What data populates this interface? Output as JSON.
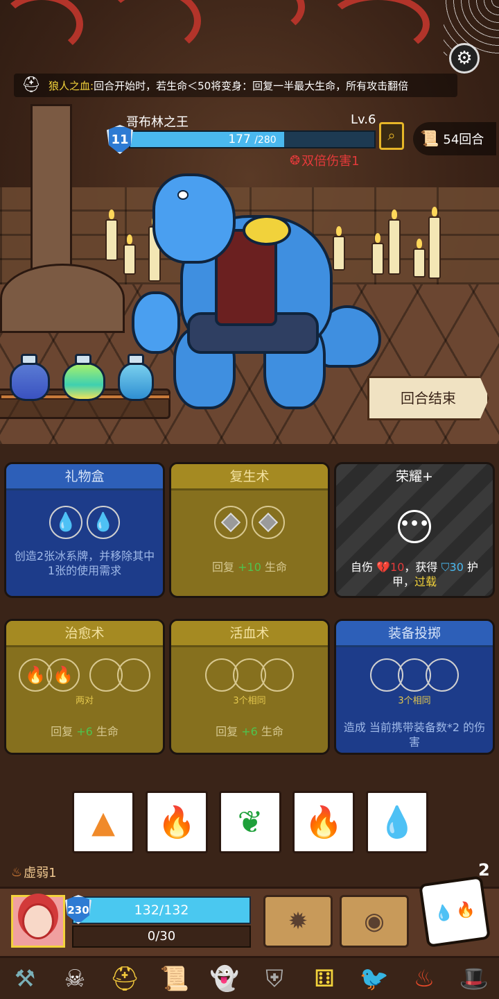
{
  "passive": {
    "icon": "knight-helmet-icon",
    "name": "狼人之血:",
    "text": "回合开始时，若生命＜50将变身：回复一半最大生命，所有攻击翻倍"
  },
  "enemy": {
    "name": "哥布林之王",
    "level": "Lv.6",
    "shield": "11",
    "hp_current": "177",
    "hp_max": "/280",
    "hp_fraction": 0.632,
    "buff": "双倍伤害1"
  },
  "turn_counter": "54回合",
  "end_turn_label": "回合结束",
  "cards": [
    {
      "title": "礼物盒",
      "desc": "创造2张冰系牌，并移除其中1张的使用需求",
      "color": "blue"
    },
    {
      "title": "复生术",
      "desc_prefix": "回复 ",
      "desc_plus": "+10",
      "desc_suffix": " 生命",
      "color": "olive"
    },
    {
      "title": "荣耀+",
      "desc_a": "自伤 ",
      "desc_a_num": "10",
      "desc_b": "，获得 ",
      "desc_b_num": "30",
      "desc_c": " 护甲，",
      "desc_d": "过载",
      "color": "grey"
    },
    {
      "title": "治愈术",
      "req": "两对",
      "desc_prefix": "回复 ",
      "desc_plus": "+6",
      "desc_suffix": " 生命",
      "color": "olive"
    },
    {
      "title": "活血术",
      "req": "3个相同",
      "desc_prefix": "回复 ",
      "desc_plus": "+6",
      "desc_suffix": " 生命",
      "color": "olive"
    },
    {
      "title": "装备投掷",
      "req": "3个相同",
      "desc": "造成 当前携带装备数*2 的伤害",
      "color": "blue"
    }
  ],
  "dice": [
    {
      "face": "earth",
      "color": "#f08a2a"
    },
    {
      "face": "fire",
      "color": "#e83a2a"
    },
    {
      "face": "leaf",
      "color": "#1ea03a"
    },
    {
      "face": "fire",
      "color": "#e83a2a"
    },
    {
      "face": "water",
      "color": "#2b7fe6"
    }
  ],
  "status": {
    "weak_label": "虚弱1",
    "dice_count": "2"
  },
  "player": {
    "shield": "230",
    "hp": "132/132",
    "xp": "0/30"
  },
  "relics": [
    "sickle-icon",
    "horned-skull-icon",
    "golden-helmet-icon",
    "scroll-icon",
    "ghost-slime-icon",
    "iron-helmet-icon",
    "golden-die-icon",
    "crow-mask-icon",
    "flame-hood-icon",
    "wizard-hat-icon"
  ]
}
